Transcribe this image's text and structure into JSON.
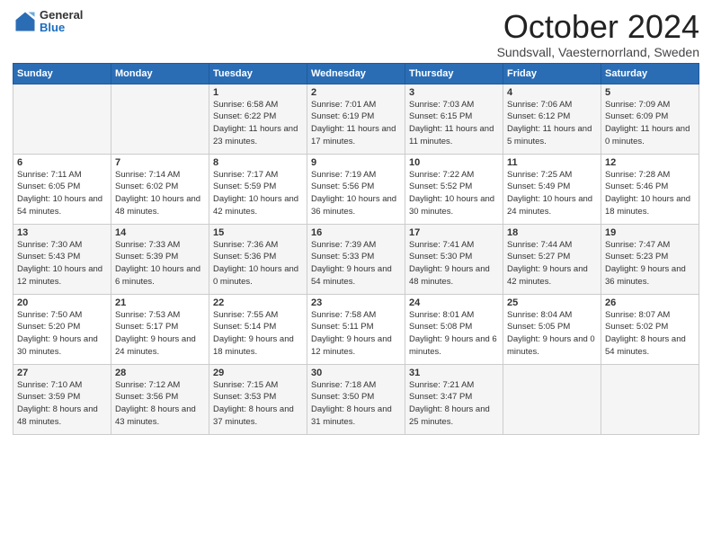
{
  "logo": {
    "general": "General",
    "blue": "Blue"
  },
  "title": "October 2024",
  "subtitle": "Sundsvall, Vaesternorrland, Sweden",
  "headers": [
    "Sunday",
    "Monday",
    "Tuesday",
    "Wednesday",
    "Thursday",
    "Friday",
    "Saturday"
  ],
  "weeks": [
    [
      {
        "day": "",
        "sunrise": "",
        "sunset": "",
        "daylight": ""
      },
      {
        "day": "",
        "sunrise": "",
        "sunset": "",
        "daylight": ""
      },
      {
        "day": "1",
        "sunrise": "Sunrise: 6:58 AM",
        "sunset": "Sunset: 6:22 PM",
        "daylight": "Daylight: 11 hours and 23 minutes."
      },
      {
        "day": "2",
        "sunrise": "Sunrise: 7:01 AM",
        "sunset": "Sunset: 6:19 PM",
        "daylight": "Daylight: 11 hours and 17 minutes."
      },
      {
        "day": "3",
        "sunrise": "Sunrise: 7:03 AM",
        "sunset": "Sunset: 6:15 PM",
        "daylight": "Daylight: 11 hours and 11 minutes."
      },
      {
        "day": "4",
        "sunrise": "Sunrise: 7:06 AM",
        "sunset": "Sunset: 6:12 PM",
        "daylight": "Daylight: 11 hours and 5 minutes."
      },
      {
        "day": "5",
        "sunrise": "Sunrise: 7:09 AM",
        "sunset": "Sunset: 6:09 PM",
        "daylight": "Daylight: 11 hours and 0 minutes."
      }
    ],
    [
      {
        "day": "6",
        "sunrise": "Sunrise: 7:11 AM",
        "sunset": "Sunset: 6:05 PM",
        "daylight": "Daylight: 10 hours and 54 minutes."
      },
      {
        "day": "7",
        "sunrise": "Sunrise: 7:14 AM",
        "sunset": "Sunset: 6:02 PM",
        "daylight": "Daylight: 10 hours and 48 minutes."
      },
      {
        "day": "8",
        "sunrise": "Sunrise: 7:17 AM",
        "sunset": "Sunset: 5:59 PM",
        "daylight": "Daylight: 10 hours and 42 minutes."
      },
      {
        "day": "9",
        "sunrise": "Sunrise: 7:19 AM",
        "sunset": "Sunset: 5:56 PM",
        "daylight": "Daylight: 10 hours and 36 minutes."
      },
      {
        "day": "10",
        "sunrise": "Sunrise: 7:22 AM",
        "sunset": "Sunset: 5:52 PM",
        "daylight": "Daylight: 10 hours and 30 minutes."
      },
      {
        "day": "11",
        "sunrise": "Sunrise: 7:25 AM",
        "sunset": "Sunset: 5:49 PM",
        "daylight": "Daylight: 10 hours and 24 minutes."
      },
      {
        "day": "12",
        "sunrise": "Sunrise: 7:28 AM",
        "sunset": "Sunset: 5:46 PM",
        "daylight": "Daylight: 10 hours and 18 minutes."
      }
    ],
    [
      {
        "day": "13",
        "sunrise": "Sunrise: 7:30 AM",
        "sunset": "Sunset: 5:43 PM",
        "daylight": "Daylight: 10 hours and 12 minutes."
      },
      {
        "day": "14",
        "sunrise": "Sunrise: 7:33 AM",
        "sunset": "Sunset: 5:39 PM",
        "daylight": "Daylight: 10 hours and 6 minutes."
      },
      {
        "day": "15",
        "sunrise": "Sunrise: 7:36 AM",
        "sunset": "Sunset: 5:36 PM",
        "daylight": "Daylight: 10 hours and 0 minutes."
      },
      {
        "day": "16",
        "sunrise": "Sunrise: 7:39 AM",
        "sunset": "Sunset: 5:33 PM",
        "daylight": "Daylight: 9 hours and 54 minutes."
      },
      {
        "day": "17",
        "sunrise": "Sunrise: 7:41 AM",
        "sunset": "Sunset: 5:30 PM",
        "daylight": "Daylight: 9 hours and 48 minutes."
      },
      {
        "day": "18",
        "sunrise": "Sunrise: 7:44 AM",
        "sunset": "Sunset: 5:27 PM",
        "daylight": "Daylight: 9 hours and 42 minutes."
      },
      {
        "day": "19",
        "sunrise": "Sunrise: 7:47 AM",
        "sunset": "Sunset: 5:23 PM",
        "daylight": "Daylight: 9 hours and 36 minutes."
      }
    ],
    [
      {
        "day": "20",
        "sunrise": "Sunrise: 7:50 AM",
        "sunset": "Sunset: 5:20 PM",
        "daylight": "Daylight: 9 hours and 30 minutes."
      },
      {
        "day": "21",
        "sunrise": "Sunrise: 7:53 AM",
        "sunset": "Sunset: 5:17 PM",
        "daylight": "Daylight: 9 hours and 24 minutes."
      },
      {
        "day": "22",
        "sunrise": "Sunrise: 7:55 AM",
        "sunset": "Sunset: 5:14 PM",
        "daylight": "Daylight: 9 hours and 18 minutes."
      },
      {
        "day": "23",
        "sunrise": "Sunrise: 7:58 AM",
        "sunset": "Sunset: 5:11 PM",
        "daylight": "Daylight: 9 hours and 12 minutes."
      },
      {
        "day": "24",
        "sunrise": "Sunrise: 8:01 AM",
        "sunset": "Sunset: 5:08 PM",
        "daylight": "Daylight: 9 hours and 6 minutes."
      },
      {
        "day": "25",
        "sunrise": "Sunrise: 8:04 AM",
        "sunset": "Sunset: 5:05 PM",
        "daylight": "Daylight: 9 hours and 0 minutes."
      },
      {
        "day": "26",
        "sunrise": "Sunrise: 8:07 AM",
        "sunset": "Sunset: 5:02 PM",
        "daylight": "Daylight: 8 hours and 54 minutes."
      }
    ],
    [
      {
        "day": "27",
        "sunrise": "Sunrise: 7:10 AM",
        "sunset": "Sunset: 3:59 PM",
        "daylight": "Daylight: 8 hours and 48 minutes."
      },
      {
        "day": "28",
        "sunrise": "Sunrise: 7:12 AM",
        "sunset": "Sunset: 3:56 PM",
        "daylight": "Daylight: 8 hours and 43 minutes."
      },
      {
        "day": "29",
        "sunrise": "Sunrise: 7:15 AM",
        "sunset": "Sunset: 3:53 PM",
        "daylight": "Daylight: 8 hours and 37 minutes."
      },
      {
        "day": "30",
        "sunrise": "Sunrise: 7:18 AM",
        "sunset": "Sunset: 3:50 PM",
        "daylight": "Daylight: 8 hours and 31 minutes."
      },
      {
        "day": "31",
        "sunrise": "Sunrise: 7:21 AM",
        "sunset": "Sunset: 3:47 PM",
        "daylight": "Daylight: 8 hours and 25 minutes."
      },
      {
        "day": "",
        "sunrise": "",
        "sunset": "",
        "daylight": ""
      },
      {
        "day": "",
        "sunrise": "",
        "sunset": "",
        "daylight": ""
      }
    ]
  ]
}
